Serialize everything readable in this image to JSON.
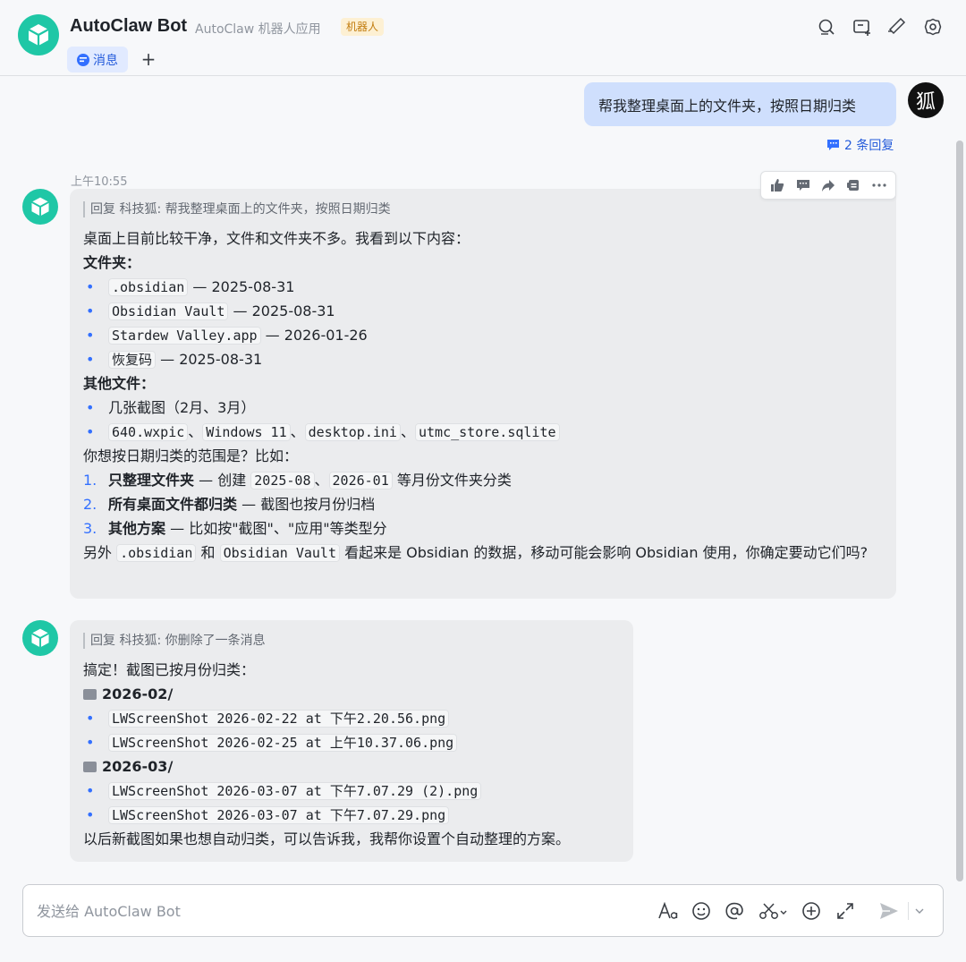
{
  "header": {
    "title": "AutoClaw Bot",
    "subtitle": "AutoClaw 机器人应用",
    "tag": "机器人",
    "tab_label": "消息",
    "add_tab": "+"
  },
  "user_message": {
    "text": "帮我整理桌面上的文件夹，按照日期归类",
    "avatar_char": "狐",
    "reply_count": "2 条回复"
  },
  "timestamp": "上午10:55",
  "reply1": {
    "quote": "回复 科技狐: 帮我整理桌面上的文件夹，按照日期归类",
    "intro": "桌面上目前比较干净，文件和文件夹不多。我看到以下内容：",
    "folders_heading": "文件夹：",
    "folders": [
      {
        "name": ".obsidian",
        "date": " — 2025-08-31"
      },
      {
        "name": "Obsidian Vault",
        "date": " — 2025-08-31"
      },
      {
        "name": "Stardew Valley.app",
        "date": " — 2026-01-26"
      },
      {
        "name": "恢复码",
        "date": " — 2025-08-31"
      }
    ],
    "other_heading": "其他文件：",
    "other_1": "几张截图（2月、3月）",
    "other_2_files": [
      "640.wxpic",
      "Windows 11",
      "desktop.ini",
      "utmc_store.sqlite"
    ],
    "sep": "、",
    "question": "你想按日期归类的范围是？比如：",
    "opt1_num": "1.",
    "opt1_bold": "只整理文件夹",
    "opt1_text": " — 创建 ",
    "opt1_code1": "2025-08",
    "opt1_sep": "、",
    "opt1_code2": "2026-01",
    "opt1_tail": " 等月份文件夹分类",
    "opt2_num": "2.",
    "opt2_bold": "所有桌面文件都归类",
    "opt2_text": " — 截图也按月份归档",
    "opt3_num": "3.",
    "opt3_bold": "其他方案",
    "opt3_text": " — 比如按\"截图\"、\"应用\"等类型分",
    "note_pre": "另外 ",
    "note_code1": ".obsidian",
    "note_and": " 和 ",
    "note_code2": "Obsidian Vault",
    "note_tail": " 看起来是 Obsidian 的数据，移动可能会影响 Obsidian 使用，你确定要动它们吗?"
  },
  "reply2": {
    "quote": "回复 科技狐: 你删除了一条消息",
    "intro": "搞定！截图已按月份归类：",
    "group1_title": "2026-02/",
    "group1_files": [
      "LWScreenShot 2026-02-22 at 下午2.20.56.png",
      "LWScreenShot 2026-02-25 at 上午10.37.06.png"
    ],
    "group2_title": "2026-03/",
    "group2_files": [
      "LWScreenShot 2026-03-07 at 下午7.07.29 (2).png",
      "LWScreenShot 2026-03-07 at 下午7.07.29.png"
    ],
    "outro": "以后新截图如果也想自动归类，可以告诉我，我帮你设置个自动整理的方案。"
  },
  "composer": {
    "placeholder": "发送给 AutoClaw Bot"
  },
  "colors": {
    "accent": "#3370ff",
    "bot_avatar": "#1fc7a6",
    "user_bubble": "#cfdffd",
    "bot_bubble": "#ebecee"
  }
}
